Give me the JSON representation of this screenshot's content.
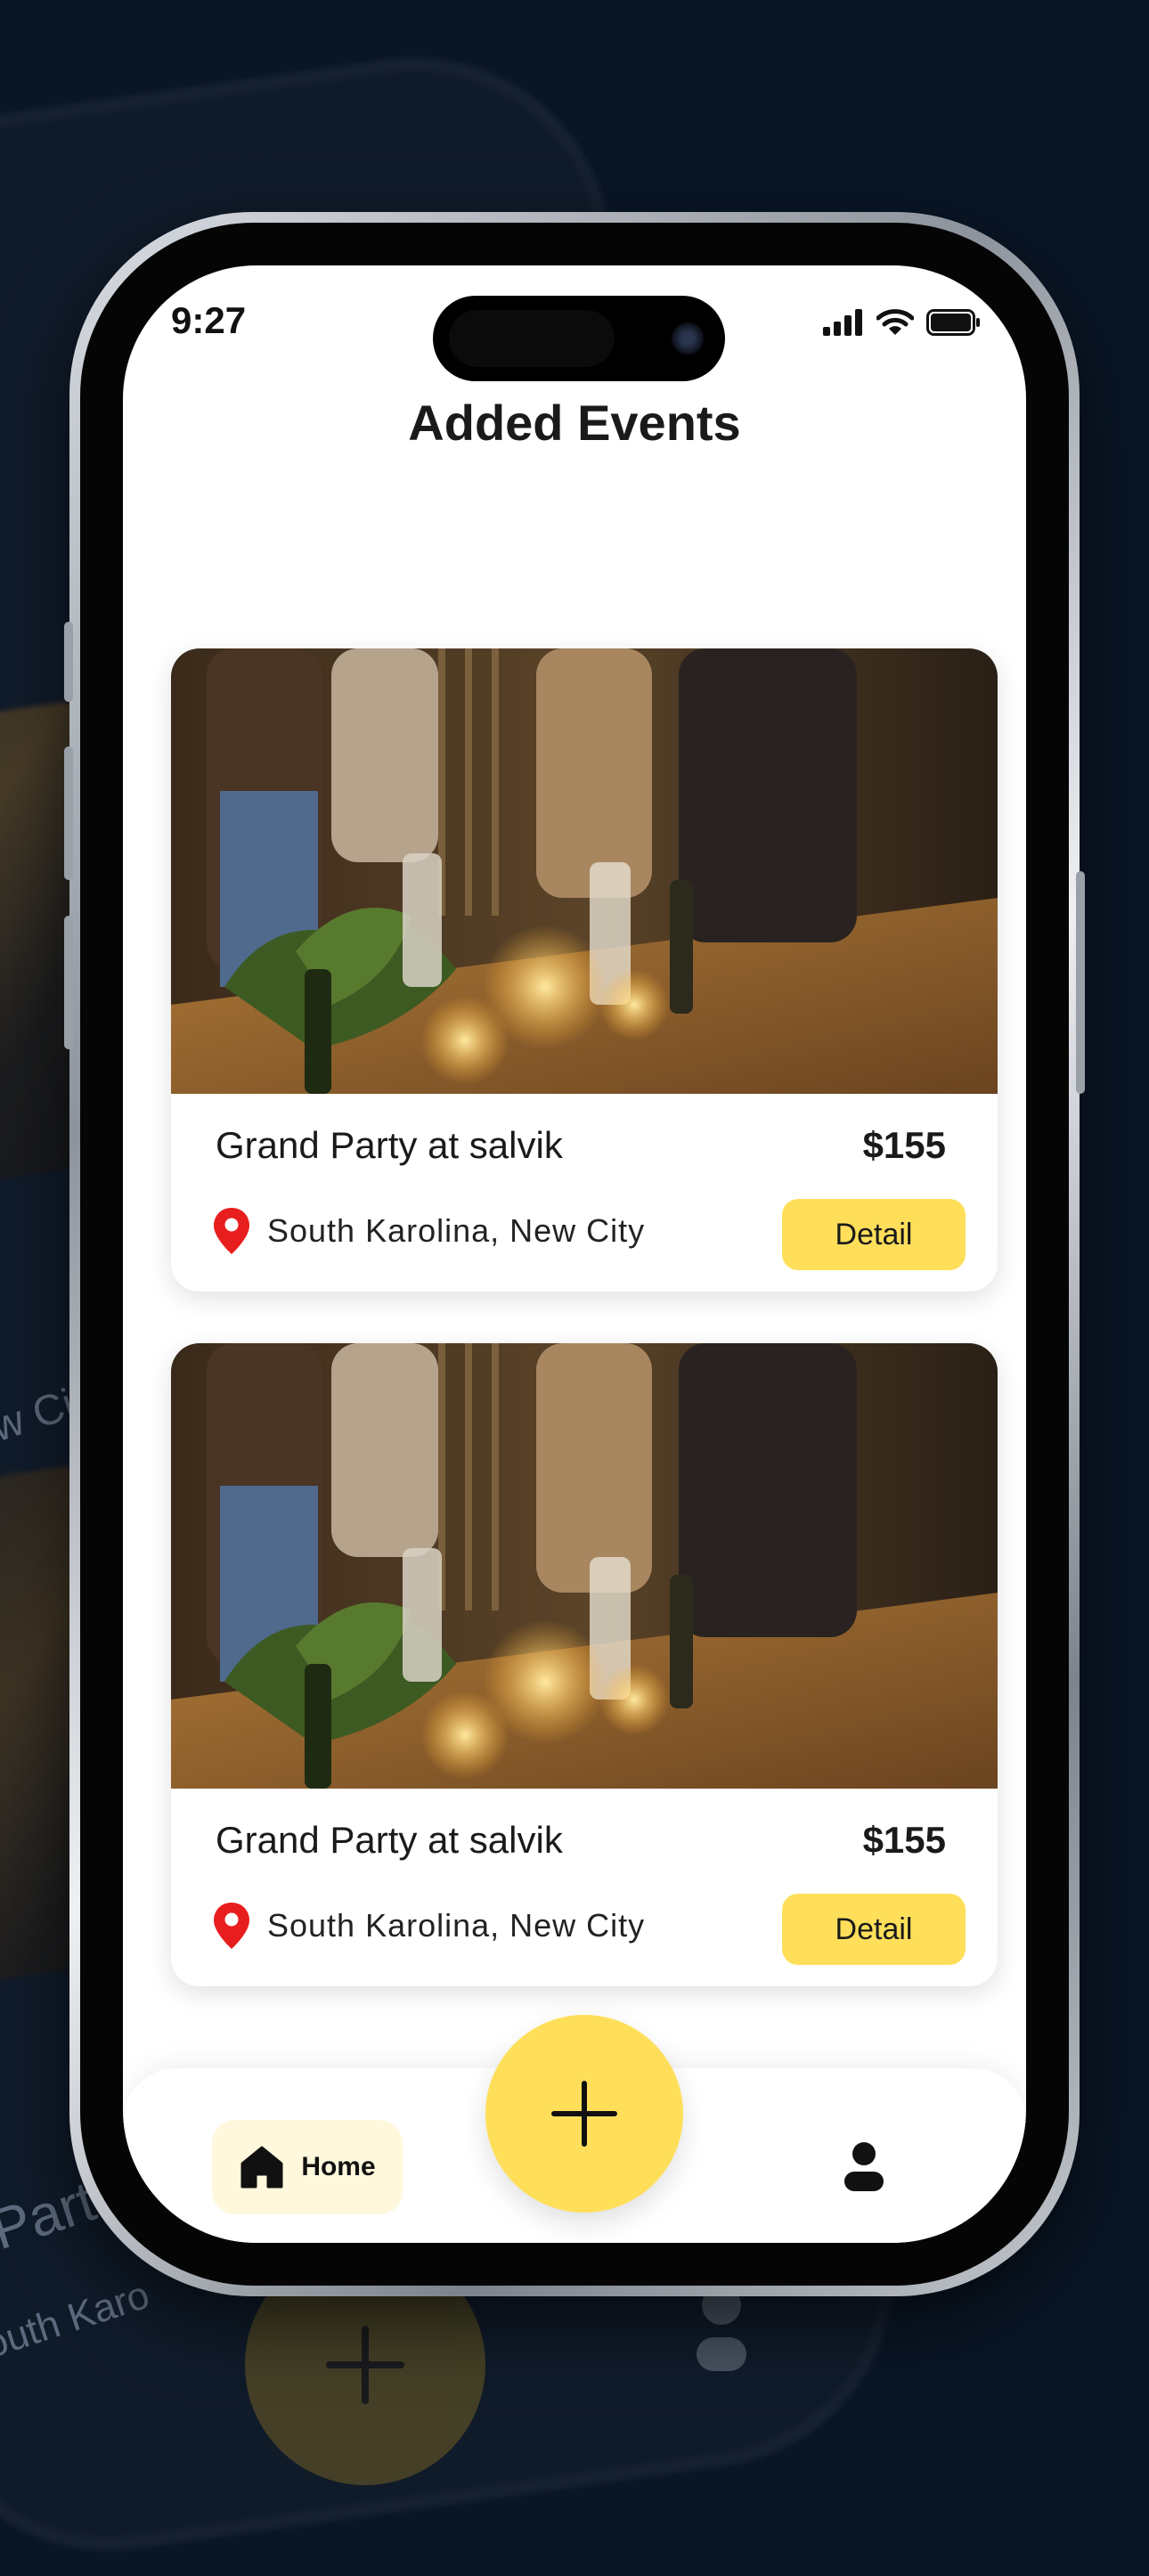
{
  "status_bar": {
    "time": "9:27"
  },
  "header": {
    "title": "Added Events"
  },
  "events": [
    {
      "title": "Grand Party at salvik",
      "price": "$155",
      "location": "South Karolina, New City",
      "button": "Detail"
    },
    {
      "title": "Grand Party at salvik",
      "price": "$155",
      "location": "South Karolina, New City",
      "button": "Detail"
    }
  ],
  "bottom_nav": {
    "home_label": "Home",
    "profile_icon": "person-icon"
  },
  "fab": {
    "icon": "plus-icon"
  },
  "background": {
    "text_1": "w Cit",
    "text_2": "Part",
    "text_3": "outh Karo"
  },
  "colors": {
    "accent": "#FFDF5A",
    "pin": "#E81E1E",
    "background": "#0A1626",
    "home_tab_bg": "#FFF8DC"
  }
}
